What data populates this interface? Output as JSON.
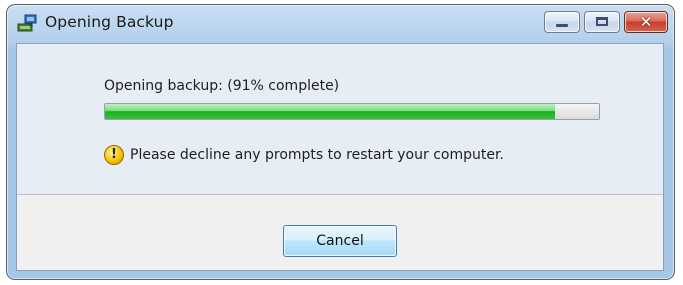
{
  "window": {
    "title": "Opening Backup",
    "buttons": {
      "minimize_icon": "minimize-icon",
      "maximize_icon": "maximize-icon",
      "close_icon": "close-icon"
    }
  },
  "content": {
    "status_text": "Opening backup: (91% complete)",
    "progress": {
      "percent": 91,
      "fill_color": "#2ec42e"
    },
    "warning": {
      "icon": "warning-icon",
      "icon_glyph": "!",
      "text": "Please decline any prompts to restart your computer."
    }
  },
  "footer": {
    "cancel_label": "Cancel"
  }
}
